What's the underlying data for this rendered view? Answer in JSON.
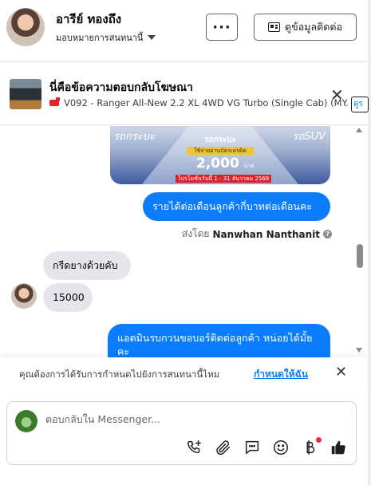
{
  "header": {
    "contact_name": "อารีย์ ทองถึง",
    "assign_label": "มอบหมายการสนทนานี้",
    "more_label": "···",
    "contact_info_label": "ดูข้อมูลติดต่อ"
  },
  "ad_reply": {
    "title": "นี่คือข้อความตอบกลับโฆษณา",
    "subtitle": "V092 - Ranger All-New 2.2 XL 4WD VG Turbo (Single Cab) (MY...",
    "tag_label": "ดูร"
  },
  "promo_image": {
    "left_text": "รถกระบะ",
    "right_text": "รถSUV",
    "headline": "รถกระบะ",
    "strip": "ใช้จ่ายผ่านบัตรเครดิต",
    "amount": "2,000",
    "amount_unit": "บาท",
    "footer": "โปรโมชั่นวันนี้ 1 - 31 ธันวาคม 2568"
  },
  "messages": {
    "out_1": "รายได้ต่อเดือนลูกค้ากี่บาทต่อเดือนคะ",
    "sent_by_prefix": "ส่งโดย",
    "sent_by_name": "Nanwhan Nanthanit",
    "in_1": "กรีดยางด้วยคับ",
    "in_2": "15000",
    "out_2": "แอดมินรบกวนขอบอร์ติดต่อลูกค้า หน่อยได้มั้ยคะ"
  },
  "assign_prompt": {
    "text": "คุณต้องการได้รับการกำหนดไปยังการสนทนานี้ไหม",
    "link": "กำหนดให้ฉัน"
  },
  "composer": {
    "placeholder": "ตอบกลับใน Messenger..."
  },
  "colors": {
    "accent": "#0a7cff",
    "incoming_bubble": "#e4e6eb",
    "notification": "#f02849"
  }
}
